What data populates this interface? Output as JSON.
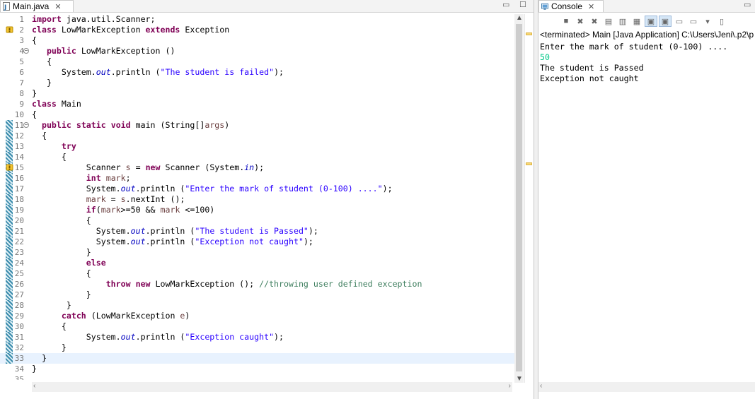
{
  "editor": {
    "tab_label": "Main.java",
    "lines": [
      {
        "n": "1",
        "text": "import java.util.Scanner;",
        "cur": false
      },
      {
        "n": "2",
        "text": "class LowMarkException extends Exception",
        "cur": false
      },
      {
        "n": "3",
        "text": "{",
        "cur": false
      },
      {
        "n": "4",
        "text": "   public LowMarkException ()",
        "cur": false
      },
      {
        "n": "5",
        "text": "   {",
        "cur": false
      },
      {
        "n": "6",
        "text": "      System.out.println (\"The student is failed\");",
        "cur": false
      },
      {
        "n": "7",
        "text": "   }",
        "cur": false
      },
      {
        "n": "8",
        "text": "}",
        "cur": false
      },
      {
        "n": "9",
        "text": "class Main",
        "cur": false
      },
      {
        "n": "10",
        "text": "{",
        "cur": false
      },
      {
        "n": "11",
        "text": "  public static void main (String[]args)",
        "cur": false
      },
      {
        "n": "12",
        "text": "  {",
        "cur": false
      },
      {
        "n": "13",
        "text": "      try",
        "cur": false
      },
      {
        "n": "14",
        "text": "      {",
        "cur": false
      },
      {
        "n": "15",
        "text": "           Scanner s = new Scanner (System.in);",
        "cur": false
      },
      {
        "n": "16",
        "text": "           int mark;",
        "cur": false
      },
      {
        "n": "17",
        "text": "           System.out.println (\"Enter the mark of student (0-100) ....\");",
        "cur": false
      },
      {
        "n": "18",
        "text": "           mark = s.nextInt ();",
        "cur": false
      },
      {
        "n": "19",
        "text": "           if(mark>=50 && mark <=100)",
        "cur": false
      },
      {
        "n": "20",
        "text": "           {",
        "cur": false
      },
      {
        "n": "21",
        "text": "             System.out.println (\"The student is Passed\");",
        "cur": false
      },
      {
        "n": "22",
        "text": "             System.out.println (\"Exception not caught\");",
        "cur": false
      },
      {
        "n": "23",
        "text": "           }",
        "cur": false
      },
      {
        "n": "24",
        "text": "           else",
        "cur": false
      },
      {
        "n": "25",
        "text": "           {",
        "cur": false
      },
      {
        "n": "26",
        "text": "               throw new LowMarkException (); //throwing user defined exception",
        "cur": false
      },
      {
        "n": "27",
        "text": "           }",
        "cur": false
      },
      {
        "n": "28",
        "text": "       }",
        "cur": false
      },
      {
        "n": "29",
        "text": "      catch (LowMarkException e)",
        "cur": false
      },
      {
        "n": "30",
        "text": "      {",
        "cur": false
      },
      {
        "n": "31",
        "text": "           System.out.println (\"Exception caught\");",
        "cur": false
      },
      {
        "n": "32",
        "text": "      }",
        "cur": false
      },
      {
        "n": "33",
        "text": "  }",
        "cur": true
      },
      {
        "n": "34",
        "text": "}",
        "cur": false
      },
      {
        "n": "35",
        "text": "",
        "cur": false
      }
    ]
  },
  "console": {
    "tab_label": "Console",
    "status": "<terminated> Main [Java Application] C:\\Users\\Jeni\\.p2\\p",
    "output": [
      {
        "text": "Enter the mark of student (0-100) ....",
        "kind": "out"
      },
      {
        "text": "50",
        "kind": "input"
      },
      {
        "text": "The student is Passed",
        "kind": "out"
      },
      {
        "text": "Exception not caught",
        "kind": "out"
      }
    ]
  },
  "icons": {
    "java_file": "java-file-icon",
    "console": "console-icon",
    "close": "close-icon",
    "minimize": "minimize-icon",
    "maximize": "maximize-icon",
    "warning": "warning-icon"
  },
  "colors": {
    "keyword": "#7f0055",
    "string": "#2a00ff",
    "field": "#0000c0",
    "comment": "#3f7f5f",
    "input_text": "#00c887",
    "current_line": "#e8f2fe"
  }
}
